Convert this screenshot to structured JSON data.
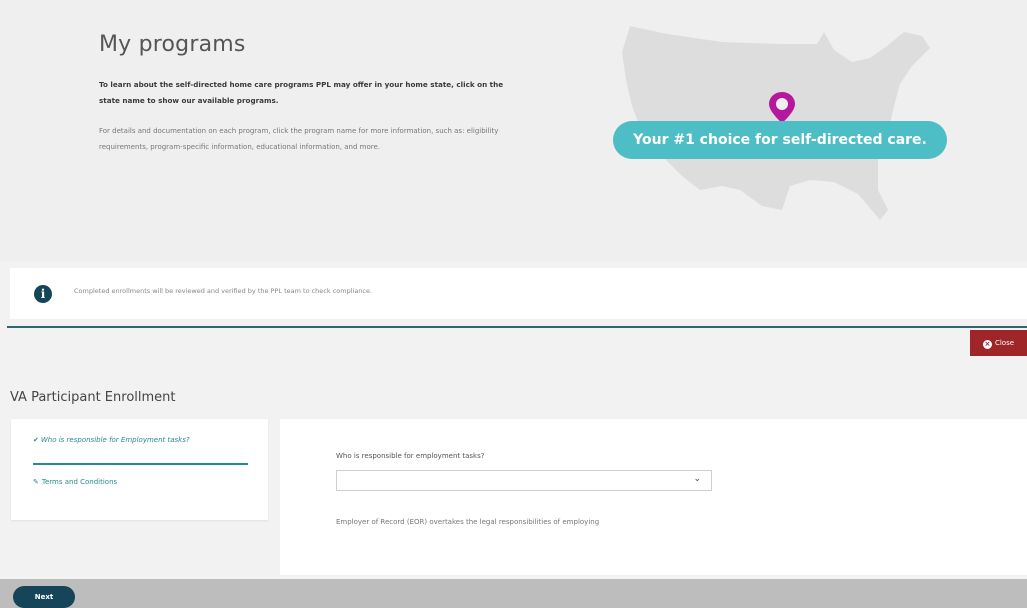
{
  "hero": {
    "title": "My programs",
    "bold_text": "To learn about the self-directed home care programs PPL may offer in your home state, click on the state name to show our available programs.",
    "body_text": "For details and documentation on each program, click the program name for more information, such as: eligibility requirements, program-specific information, educational information, and more.",
    "tagline": "Your #1 choice for self-directed care.",
    "map_icon": "us-map-illustration",
    "pin_icon": "location-pin-icon",
    "colors": {
      "tagline_bg": "#4dbdc6",
      "pin": "#b5179e",
      "map": "#dddddd"
    }
  },
  "info": {
    "text": "Completed enrollments will be reviewed and verified by the PPL team to check compliance.",
    "icon": "info-icon"
  },
  "close_label": "Close",
  "enrollment": {
    "title": "VA Participant Enrollment",
    "steps": [
      {
        "label": "Who is responsible for Employment tasks?",
        "status": "complete",
        "icon": "checkmark-icon"
      },
      {
        "label": "Terms and Conditions",
        "status": "pending",
        "icon": "pencil-icon"
      }
    ],
    "question": "Who is responsible for employment tasks?",
    "select_value": "",
    "description": "Employer of Record (EOR) overtakes the legal responsibilities of employing"
  },
  "next_label": "Next",
  "colors": {
    "teal": "#2a8a93",
    "navy": "#16455a",
    "close_red": "#9f2628"
  }
}
